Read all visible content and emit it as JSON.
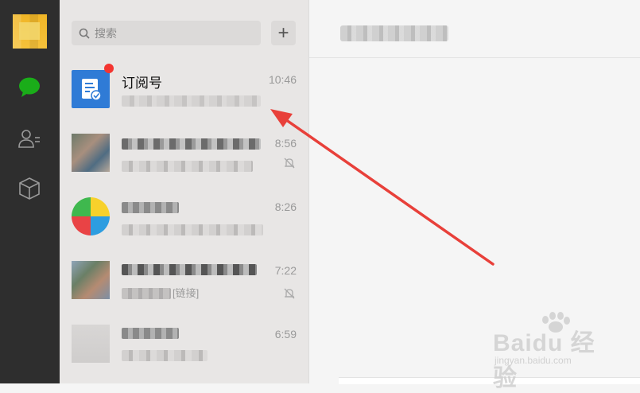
{
  "search": {
    "placeholder": "搜索"
  },
  "toolbar": {
    "add_label": "+"
  },
  "chats": [
    {
      "title": "订阅号",
      "time": "10:46",
      "unread": true
    },
    {
      "title": "",
      "time": "8:56",
      "muted": true
    },
    {
      "title": "",
      "time": "8:26"
    },
    {
      "title": "",
      "time": "7:22",
      "subtitle_visible": "[链接]",
      "muted": true
    },
    {
      "title": "",
      "time": "6:59"
    }
  ],
  "watermark": {
    "brand": "Baidu 经验",
    "url": "jingyan.baidu.com"
  },
  "colors": {
    "accent_green": "#1aad19",
    "rail_bg": "#2e2e2e",
    "badge_red": "#f43530",
    "arrow_red": "#e8403a"
  }
}
